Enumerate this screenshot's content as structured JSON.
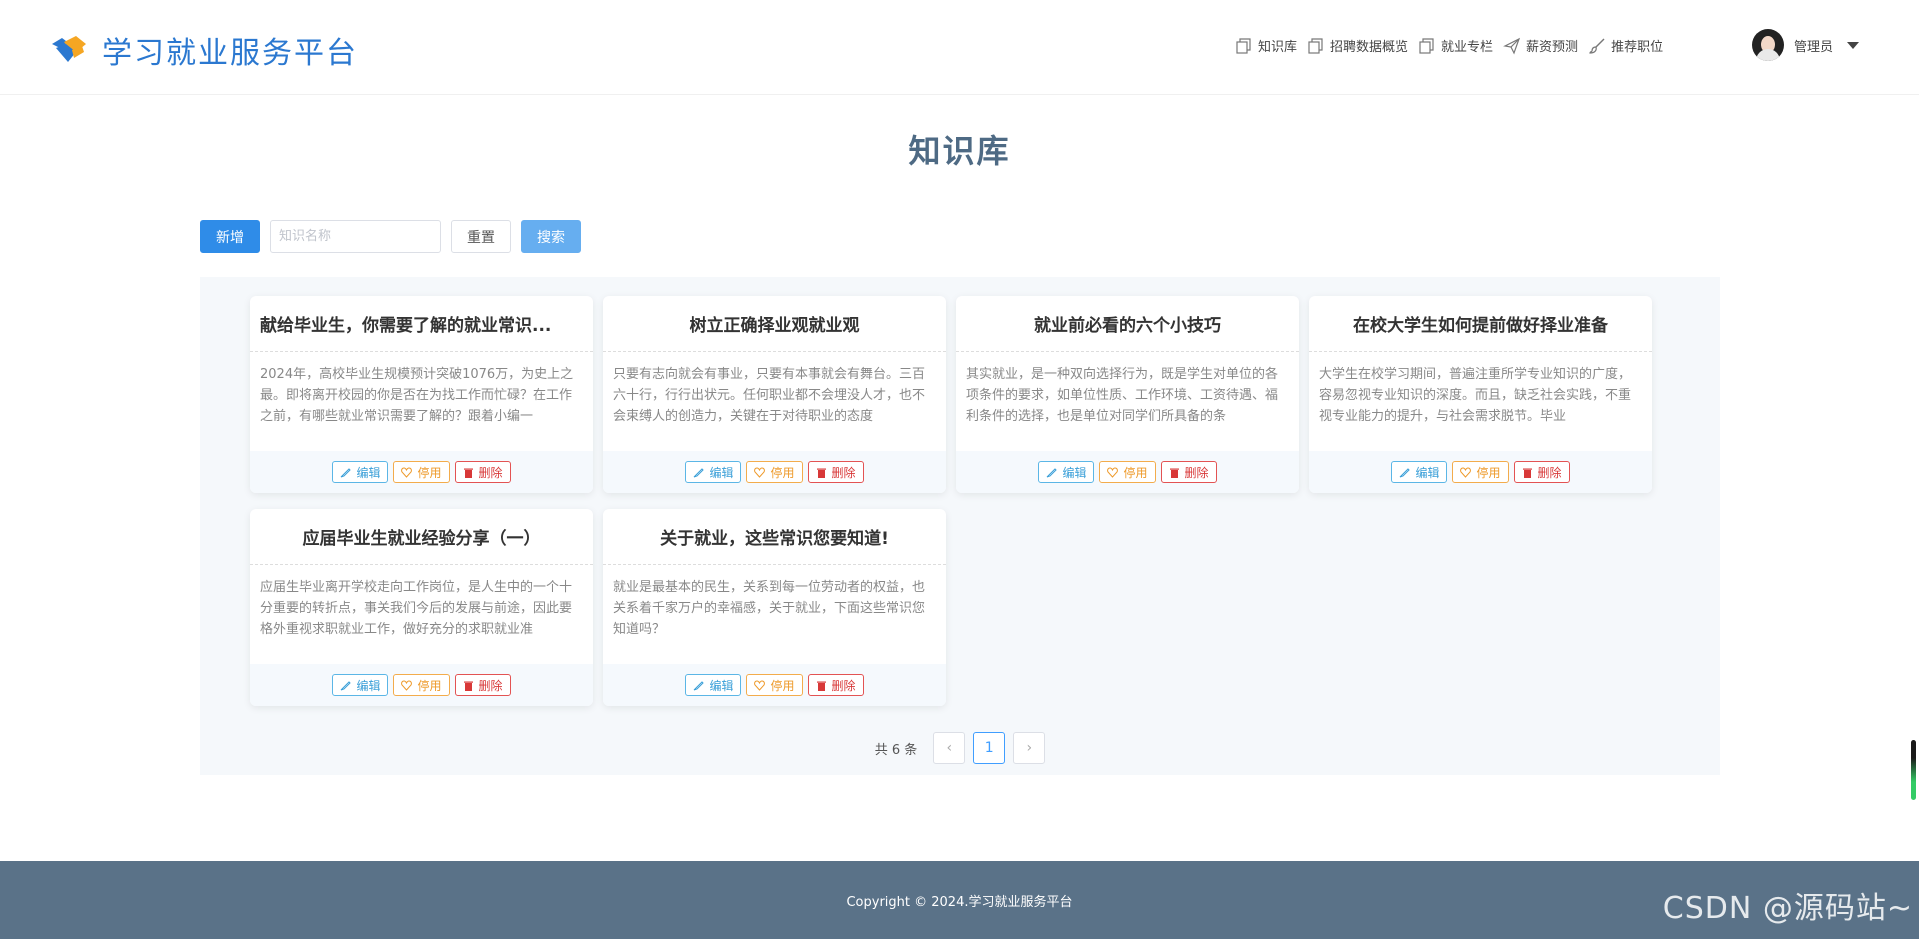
{
  "app": {
    "title": "学习就业服务平台"
  },
  "nav": {
    "items": [
      {
        "label": "知识库",
        "icon": "copy-icon"
      },
      {
        "label": "招聘数据概览",
        "icon": "copy-icon"
      },
      {
        "label": "就业专栏",
        "icon": "copy-icon"
      },
      {
        "label": "薪资预测",
        "icon": "send-icon"
      },
      {
        "label": "推荐职位",
        "icon": "brush-icon"
      }
    ],
    "user": "管理员"
  },
  "page": {
    "title": "知识库"
  },
  "toolbar": {
    "add_label": "新增",
    "search_placeholder": "知识名称",
    "reset_label": "重置",
    "search_label": "搜索"
  },
  "cards": [
    {
      "title": "献给毕业生，你需要了解的就业常识...",
      "body": "2024年，高校毕业生规模预计突破1076万，为史上之最。即将离开校园的你是否在为找工作而忙碌？在工作之前，有哪些就业常识需要了解的？跟着小编一"
    },
    {
      "title": "树立正确择业观就业观",
      "body": "只要有志向就会有事业，只要有本事就会有舞台。三百六十行，行行出状元。任何职业都不会埋没人才，也不会束缚人的创造力，关键在于对待职业的态度"
    },
    {
      "title": "就业前必看的六个小技巧",
      "body": "其实就业，是一种双向选择行为，既是学生对单位的各项条件的要求，如单位性质、工作环境、工资待遇、福利条件的选择，也是单位对同学们所具备的条"
    },
    {
      "title": "在校大学生如何提前做好择业准备",
      "body": "大学生在校学习期间，普遍注重所学专业知识的广度，容易忽视专业知识的深度。而且，缺乏社会实践，不重视专业能力的提升，与社会需求脱节。毕业"
    },
    {
      "title": "应届毕业生就业经验分享（一）",
      "body": "应届生毕业离开学校走向工作岗位，是人生中的一个十分重要的转折点，事关我们今后的发展与前途，因此要格外重视求职就业工作，做好充分的求职就业准"
    },
    {
      "title": "关于就业，这些常识您要知道!",
      "body": "就业是最基本的民生，关系到每一位劳动者的权益，也关系着千家万户的幸福感，关于就业，下面这些常识您知道吗？"
    }
  ],
  "card_actions": {
    "edit": "编辑",
    "disable": "停用",
    "delete": "删除"
  },
  "pagination": {
    "total_text": "共 6 条",
    "prev": "‹",
    "current": "1",
    "next": "›"
  },
  "footer": {
    "copyright": "Copyright © 2024.学习就业服务平台",
    "watermark": "CSDN @源码站~"
  },
  "colors": {
    "primary": "#2f8ce8",
    "brand_text": "#2b78d0",
    "title": "#4e6a84",
    "footer_bg": "#5a7288"
  }
}
